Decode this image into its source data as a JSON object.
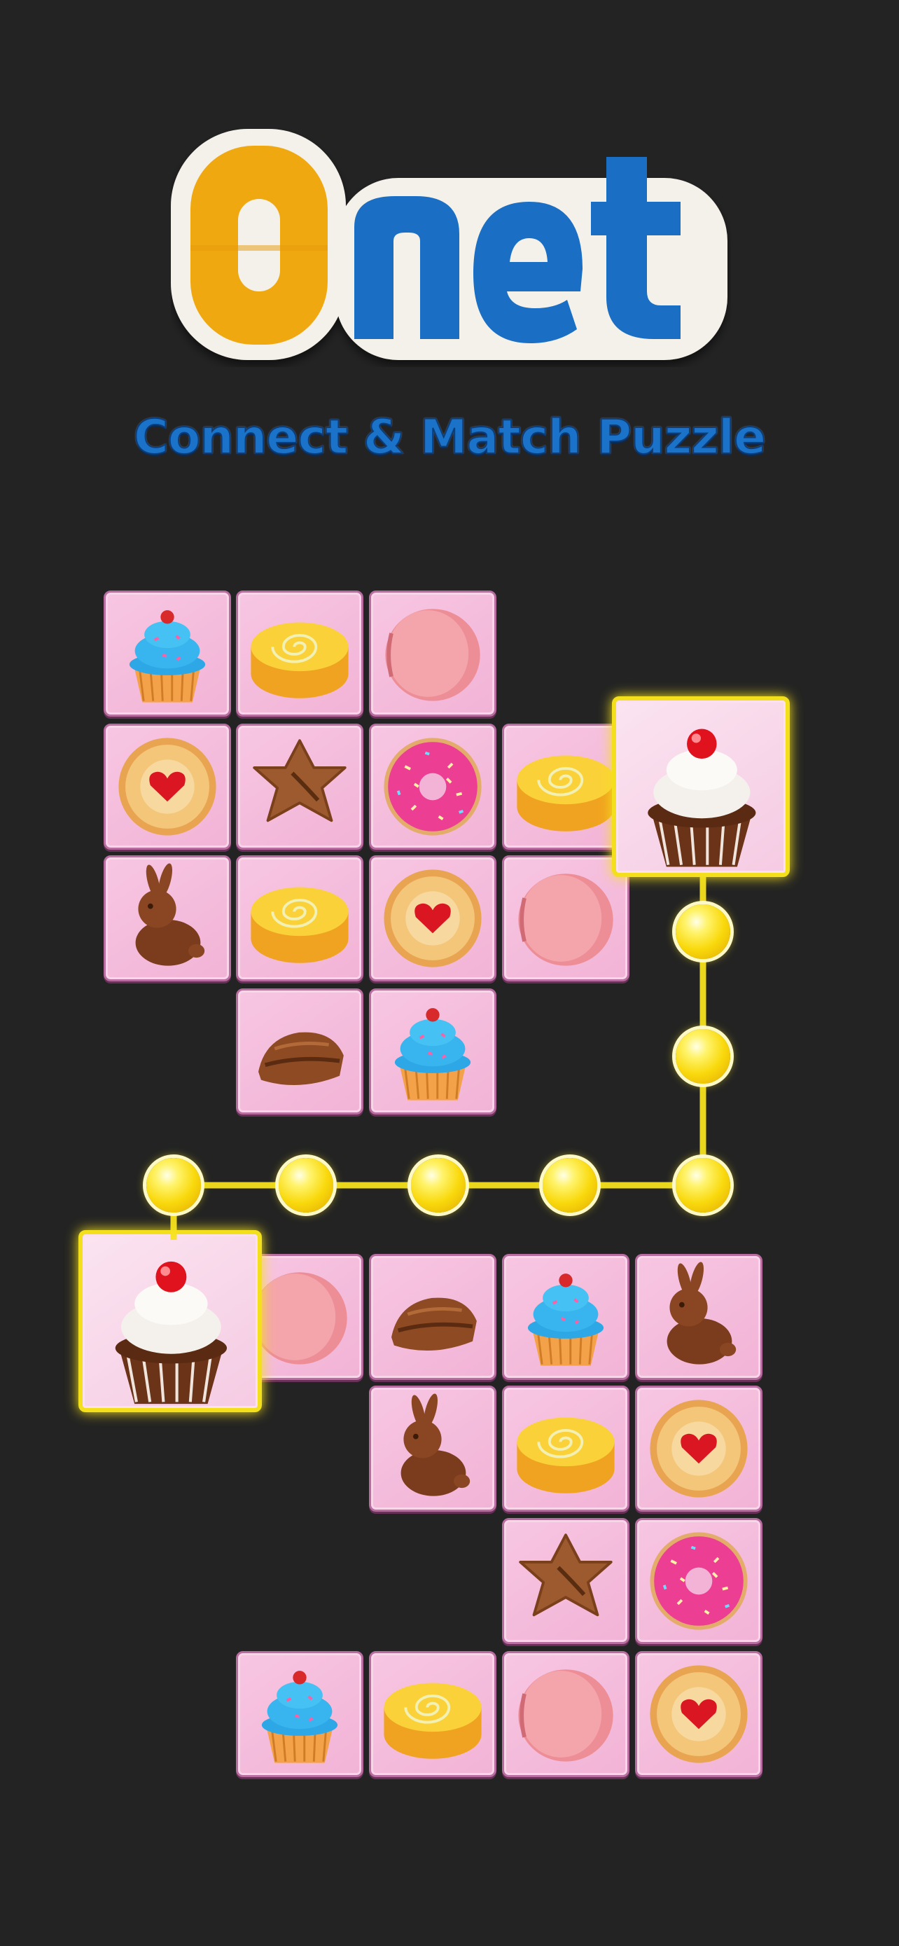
{
  "title": {
    "logo_o": "O",
    "logo_net": "net",
    "subtitle": "Connect & Match Puzzle"
  },
  "colors": {
    "background": "#232323",
    "tile": "#f2b3d6",
    "path": "#f6e21d",
    "logo_orange": "#f0a810",
    "logo_blue": "#1a6fc4"
  },
  "board": {
    "tiles": [
      {
        "id": "r0c0",
        "item": "cupcake-blue"
      },
      {
        "id": "r0c1",
        "item": "swiss-roll"
      },
      {
        "id": "r0c2",
        "item": "macaron"
      },
      {
        "id": "r1c0",
        "item": "jam-cookie"
      },
      {
        "id": "r1c1",
        "item": "chocolate-star"
      },
      {
        "id": "r1c2",
        "item": "donut"
      },
      {
        "id": "r1c3",
        "item": "swiss-roll"
      },
      {
        "id": "r2c0",
        "item": "chocolate-bunny"
      },
      {
        "id": "r2c1",
        "item": "swiss-roll"
      },
      {
        "id": "r2c2",
        "item": "jam-cookie"
      },
      {
        "id": "r2c3",
        "item": "macaron"
      },
      {
        "id": "r3c1",
        "item": "chocolate-truffle"
      },
      {
        "id": "r3c2",
        "item": "cupcake-blue"
      },
      {
        "id": "r5c1",
        "item": "macaron"
      },
      {
        "id": "r5c2",
        "item": "chocolate-truffle"
      },
      {
        "id": "r5c3",
        "item": "cupcake-blue"
      },
      {
        "id": "r5c4",
        "item": "chocolate-bunny"
      },
      {
        "id": "r6c2",
        "item": "chocolate-bunny"
      },
      {
        "id": "r6c3",
        "item": "swiss-roll"
      },
      {
        "id": "r6c4",
        "item": "jam-cookie"
      },
      {
        "id": "r7c3",
        "item": "chocolate-star"
      },
      {
        "id": "r7c4",
        "item": "donut"
      },
      {
        "id": "r8c1",
        "item": "cupcake-blue"
      },
      {
        "id": "r8c2",
        "item": "swiss-roll"
      },
      {
        "id": "r8c3",
        "item": "macaron"
      },
      {
        "id": "r8c4",
        "item": "jam-cookie"
      }
    ],
    "selected": [
      {
        "id": "sel-top",
        "item": "cupcake-cherry"
      },
      {
        "id": "sel-bottom",
        "item": "cupcake-cherry"
      }
    ],
    "connection_dots": 7
  }
}
